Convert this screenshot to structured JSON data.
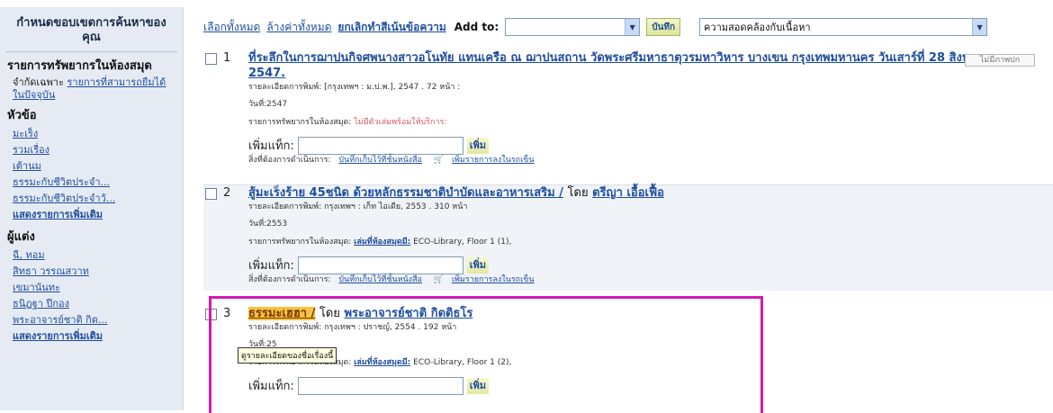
{
  "sidebar": {
    "title": "กำหนดขอบเขตการค้นหาของคุณ",
    "sections": [
      {
        "heading": "รายการทรัพยากรในห้องสมุด",
        "limit_prefix": "จำกัดเฉพาะ",
        "limit_link": "รายการที่สามารถยืมได้ในปัจจุบัน"
      },
      {
        "heading": "หัวข้อ",
        "items": [
          "มะเร็ง",
          "รวมเรื่อง",
          "เต้านม",
          "ธรรมะกับชีวิตประจำ...",
          "ธรรมะกับชีวิตประจำวั...",
          "แสดงรายการเพิ่มเติม"
        ]
      },
      {
        "heading": "ผู้แต่ง",
        "items": [
          "ฉี, ทอม",
          "สิทธา วรรณสวาท",
          "เขมานันทะ",
          "ธนิฎฐา ปีกอง",
          "พระอาจารย์ชาติ กิต...",
          "แสดงรายการเพิ่มเติม"
        ]
      }
    ]
  },
  "toolbar": {
    "select_all": "เลือกทั้งหมด",
    "clear_all": "ล้างค่าทั้งหมด",
    "unhighlight": "ยกเลิกทำสีเน้นข้อความ",
    "add_to": "Add to:",
    "add_to_value": "",
    "save": "บันทึก",
    "sort_value": "ความสอดคล้องกับเนื้อหา"
  },
  "common": {
    "details_label": "รายละเอียดการพิมพ์:",
    "date_label": "วันที่:",
    "holdings_label": "รายการทรัพยากรในห้องสมุด:",
    "tag_label": "เพิ่มแท็ก:",
    "tag_button": "เพิ่ม",
    "actions_label": "สิ่งที่ต้องการดำเนินการ:",
    "save_shelf": "บันทึกเก็บไว้ที่ชั้นหนังสือ",
    "add_cart": "เพิ่มรายการลงในรถเข็น",
    "by": "โดย",
    "no_image": "ไม่มีภาพปก"
  },
  "results": [
    {
      "number": "1",
      "title": "ที่ระลึกในการฌาปนกิจศพนางสาวอโนทัย แทนเครือ ณ ฌาปนสถาน วัดพระศรีมหาธาตุวรมหาวิหาร บางเขน กรุงเทพมหานคร วันเสาร์ที่ 28 สิงหาคม 2547.",
      "details": "[กรุงเทพฯ : ม.ป.พ.], 2547 . 72 หน้า :",
      "date": "2547",
      "holdings": "ไม่มีตัวเล่มพร้อมให้บริการ:",
      "author": ""
    },
    {
      "number": "2",
      "title": "สู้มะเร็งร้าย 45ชนิด ด้วยหลักธรรมชาติบำบัดและอาหารเสริม /",
      "details": "กรุงเทพฯ : เก็ท ไอเดีย, 2553 . 310 หน้า",
      "date": "2553",
      "holdings_avail": "เล่มที่ห้องสมุดมี:",
      "holdings_loc": "ECO-Library, Floor 1 (1),",
      "author": "ตรีญา เอื้อเฟื้อ"
    },
    {
      "number": "3",
      "title": "ธรรมะเฮฮา /",
      "details": "กรุงเทพฯ : ปราชญ์, 2554 . 192 หน้า",
      "date": "25",
      "holdings_avail": "เล่มที่ห้องสมุดมี:",
      "holdings_loc": "ECO-Library, Floor 1 (2),",
      "author": "พระอาจารย์ชาติ กิตติธโร"
    }
  ],
  "tooltip": "ดูรายละเอียดของชื่อเรื่องนี้"
}
